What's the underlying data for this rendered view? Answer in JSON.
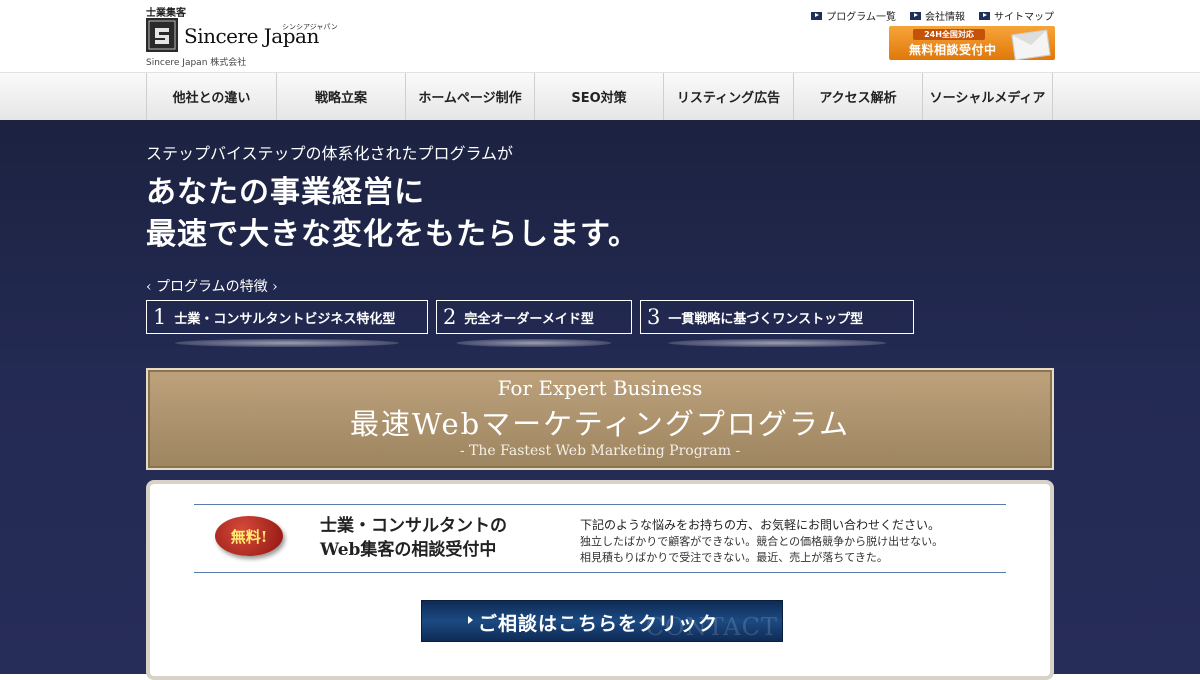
{
  "header": {
    "logo": {
      "tagline": "士業集客",
      "name": "Sincere Japan",
      "kana": "シンシアジャパン",
      "company": "Sincere Japan 株式会社"
    },
    "util_links": [
      {
        "label": "プログラム一覧",
        "icon": "play-icon"
      },
      {
        "label": "会社情報",
        "icon": "play-icon"
      },
      {
        "label": "サイトマップ",
        "icon": "play-icon"
      }
    ],
    "consult_badge": {
      "small": "24H全国対応",
      "big": "無料相談受付中",
      "icon": "envelope-icon"
    }
  },
  "nav": {
    "items": [
      {
        "label": "他社との違い"
      },
      {
        "label": "戦略立案"
      },
      {
        "label": "ホームページ制作"
      },
      {
        "label": "SEO対策"
      },
      {
        "label": "リスティング広告"
      },
      {
        "label": "アクセス解析"
      },
      {
        "label": "ソーシャルメディア"
      }
    ]
  },
  "hero": {
    "subtitle": "ステップバイステップの体系化されたプログラムが",
    "title_line1": "あなたの事業経営に",
    "title_line2": "最速で大きな変化をもたらします。",
    "features_label": "‹ プログラムの特徴 ›",
    "features": [
      {
        "num": "1",
        "text": "士業・コンサルタントビジネス特化型"
      },
      {
        "num": "2",
        "text": "完全オーダーメイド型"
      },
      {
        "num": "3",
        "text": "一貫戦略に基づくワンストップ型"
      }
    ]
  },
  "program_banner": {
    "en": "For Expert Business",
    "jp": "最速Webマーケティングプログラム",
    "sub": "- The Fastest Web Marketing Program -"
  },
  "contact_panel": {
    "free_badge": "無料!",
    "heading_line1": "士業・コンサルタントの",
    "heading_line2": "Web集客の相談受付中",
    "lead": "下記のような悩みをお持ちの方、お気軽にお問い合わせください。",
    "detail_line1": "独立したばかりで顧客ができない。競合との価格競争から脱け出せない。",
    "detail_line2": "相見積もりばかりで受注できない。最近、売上が落ちてきた。",
    "button_label": "ご相談はこちらをクリック",
    "button_bg": "CONTACT"
  },
  "colors": {
    "hero_bg": "#232a53",
    "banner_gold": "#b09571",
    "accent_orange": "#f08c1a",
    "button_navy": "#173c6e"
  }
}
